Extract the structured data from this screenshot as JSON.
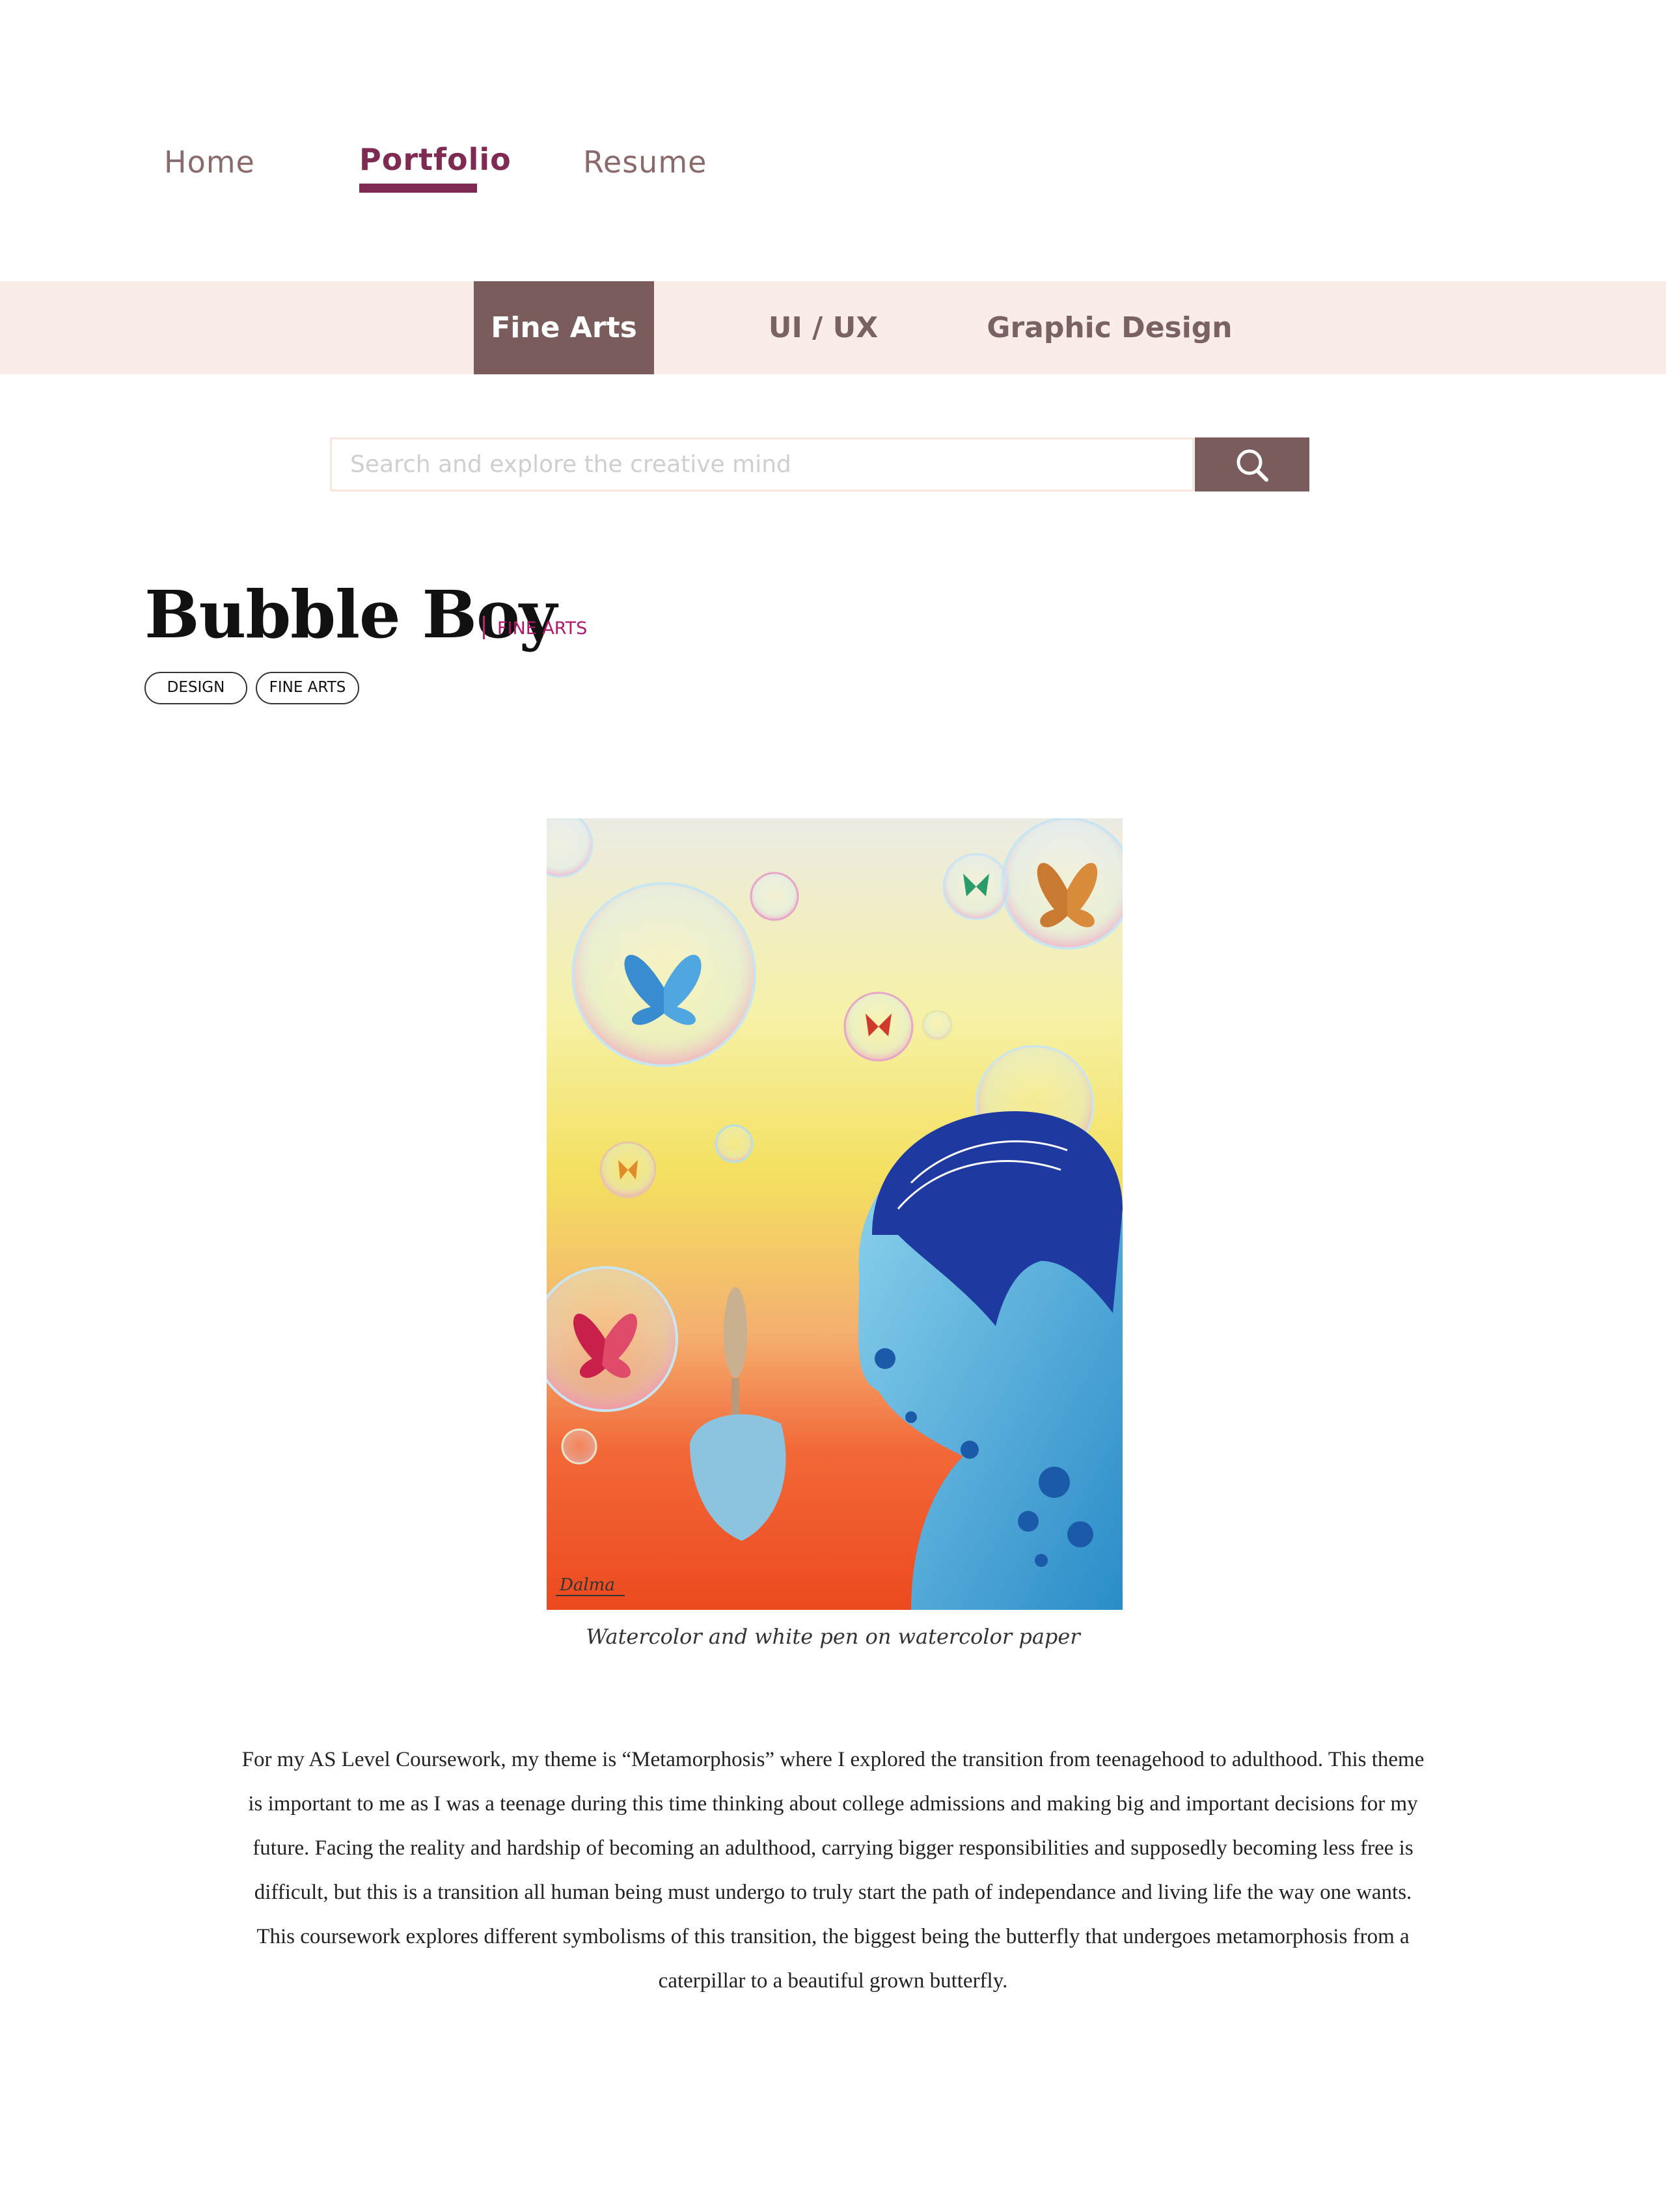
{
  "nav": {
    "items": [
      {
        "label": "Home",
        "active": false
      },
      {
        "label": "Portfolio",
        "active": true
      },
      {
        "label": "Resume",
        "active": false
      }
    ],
    "accent_color": "#7e2a52"
  },
  "categories": {
    "tabs": [
      {
        "label": "Fine Arts",
        "active": true
      },
      {
        "label": "UI / UX",
        "active": false
      },
      {
        "label": "Graphic Design",
        "active": false
      }
    ],
    "bar_color": "#faece7",
    "active_color": "#7a5c5c"
  },
  "search": {
    "placeholder": "Search and explore the creative mind",
    "value": "",
    "icon": "search-icon"
  },
  "project": {
    "title": "Bubble Boy",
    "category": "FINE ARTS",
    "tags": [
      "DESIGN",
      "FINE ARTS"
    ],
    "caption": "Watercolor and white pen on watercolor paper",
    "signature": "Dalma",
    "description": "For my AS Level Coursework, my theme is “Metamorphosis” where I explored the transition from teenagehood to adulthood. This theme is important to me as I was a teenage during this time thinking about college admissions and making big and important decisions for my future. Facing the reality and hardship of becoming an adulthood, carrying bigger responsibilities and supposedly becoming less free is difficult, but this is a transition all human being must undergo to truly start the path of independance and living life the way one wants. This coursework explores different symbolisms of this transition, the biggest being the butterfly that undergoes metamorphosis from a caterpillar to a beautiful grown butterfly."
  }
}
